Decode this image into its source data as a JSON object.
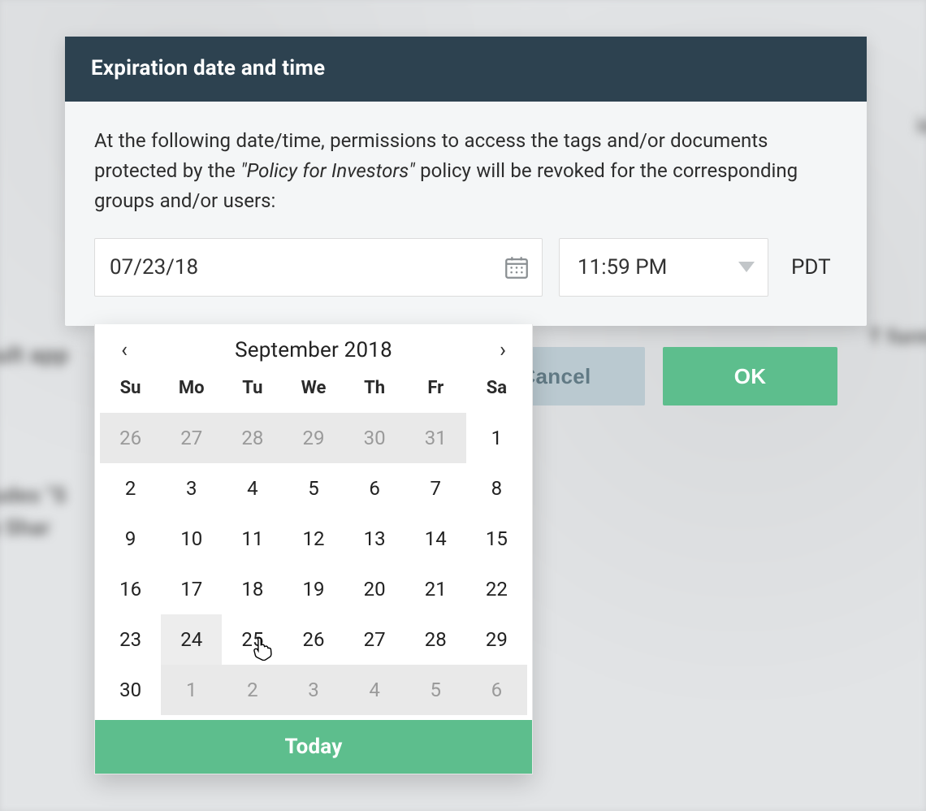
{
  "modal": {
    "title": "Expiration date and time",
    "desc_pre": "At the following date/time, permissions to access the tags and/or documents protected by the ",
    "desc_italic": "\"Policy for Investors\"",
    "desc_post": " policy will be revoked for the corresponding groups and/or users:",
    "date_value": "07/23/18",
    "time_value": "11:59 PM",
    "tz": "PDT",
    "cancel": "Cancel",
    "ok": "OK"
  },
  "calendar": {
    "month_label": "September 2018",
    "prev": "‹",
    "next": "›",
    "dow": [
      "Su",
      "Mo",
      "Tu",
      "We",
      "Th",
      "Fr",
      "Sa"
    ],
    "days": [
      {
        "n": 26,
        "other": true
      },
      {
        "n": 27,
        "other": true
      },
      {
        "n": 28,
        "other": true
      },
      {
        "n": 29,
        "other": true
      },
      {
        "n": 30,
        "other": true
      },
      {
        "n": 31,
        "other": true
      },
      {
        "n": 1
      },
      {
        "n": 2
      },
      {
        "n": 3
      },
      {
        "n": 4
      },
      {
        "n": 5
      },
      {
        "n": 6
      },
      {
        "n": 7
      },
      {
        "n": 8
      },
      {
        "n": 9
      },
      {
        "n": 10
      },
      {
        "n": 11
      },
      {
        "n": 12
      },
      {
        "n": 13
      },
      {
        "n": 14
      },
      {
        "n": 15
      },
      {
        "n": 16
      },
      {
        "n": 17
      },
      {
        "n": 18
      },
      {
        "n": 19
      },
      {
        "n": 20
      },
      {
        "n": 21
      },
      {
        "n": 22
      },
      {
        "n": 23
      },
      {
        "n": 24,
        "hover": true
      },
      {
        "n": 25
      },
      {
        "n": 26
      },
      {
        "n": 27
      },
      {
        "n": 28
      },
      {
        "n": 29
      },
      {
        "n": 30
      },
      {
        "n": 1,
        "other": true
      },
      {
        "n": 2,
        "other": true
      },
      {
        "n": 3,
        "other": true
      },
      {
        "n": 4,
        "other": true
      },
      {
        "n": 5,
        "other": true
      },
      {
        "n": 6,
        "other": true
      }
    ],
    "today": "Today"
  }
}
